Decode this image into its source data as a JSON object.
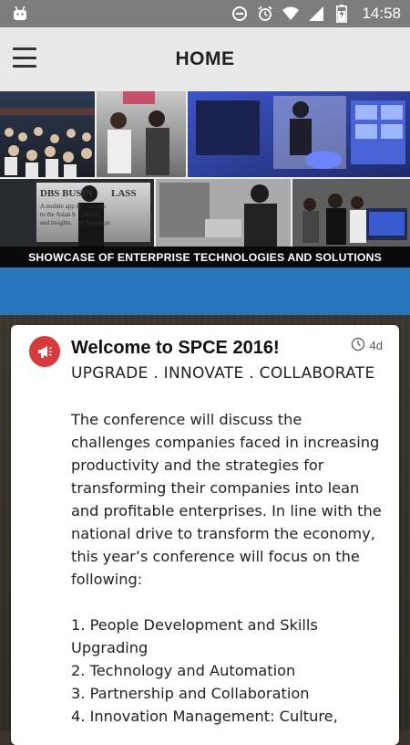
{
  "status_bar": {
    "time": "14:58",
    "icons": [
      "android-icon",
      "data-saver-icon",
      "alarm-icon",
      "wifi-icon",
      "signal-icon",
      "battery-charging-icon"
    ]
  },
  "app_bar": {
    "menu_icon": "hamburger-menu-icon",
    "title": "HOME"
  },
  "banner": {
    "caption": "SHOWCASE OF ENTERPRISE TECHNOLOGIES AND SOLUTIONS",
    "sign_text_1": "DBS BUSIN",
    "sign_text_2": "LASS",
    "sign_text_3": "A mobile app th    cts you",
    "sign_text_4": "to the Asian b    munity",
    "sign_text_5": "and insights     ur fingertips"
  },
  "post": {
    "icon": "megaphone-icon",
    "title": "Welcome to SPCE 2016!",
    "time_icon": "clock-icon",
    "time": "4d",
    "subtitle": "UPGRADE . INNOVATE . COLLABORATE",
    "body_lines": [
      "The conference will discuss the",
      "challenges companies faced in increasing",
      "productivity and the strategies for",
      "transforming their companies into lean",
      "and profitable enterprises. In line with the",
      "national drive to transform the economy,",
      "this year’s conference will focus on the",
      "following:"
    ],
    "list": [
      "1. People Development and Skills",
      "Upgrading",
      "2. Technology and Automation",
      "3. Partnership and Collaboration",
      "4. Innovation Management: Culture,"
    ]
  },
  "colors": {
    "status_bar": "#7d7d7d",
    "app_bar": "#e9e9e9",
    "accent_blue": "#2976bd",
    "icon_red": "#d63b3b"
  }
}
